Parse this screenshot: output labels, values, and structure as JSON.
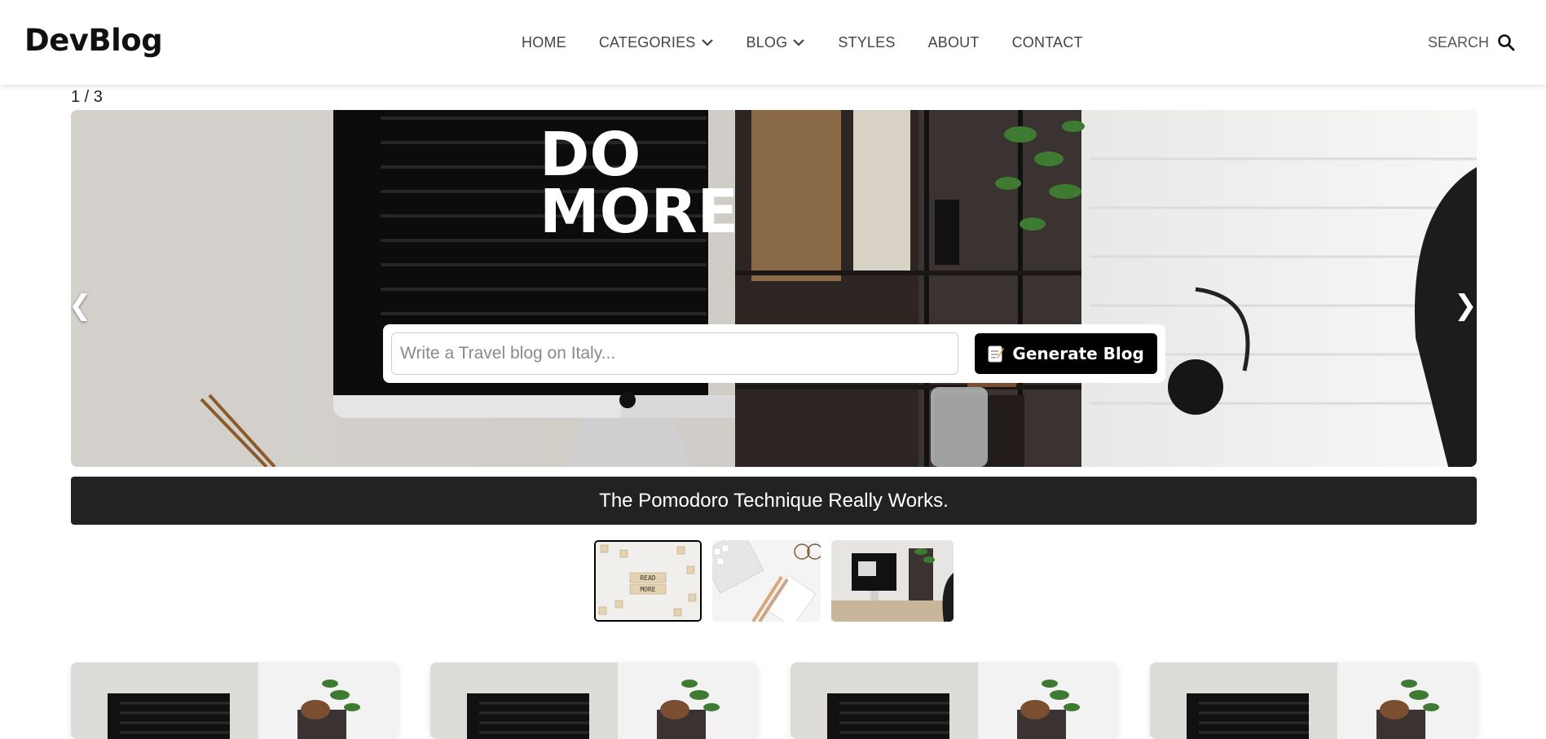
{
  "header": {
    "logo": "DevBlog",
    "nav": [
      {
        "label": "HOME",
        "dropdown": false
      },
      {
        "label": "CATEGORIES",
        "dropdown": true
      },
      {
        "label": "BLOG",
        "dropdown": true
      },
      {
        "label": "STYLES",
        "dropdown": false
      },
      {
        "label": "ABOUT",
        "dropdown": false
      },
      {
        "label": "CONTACT",
        "dropdown": false
      }
    ],
    "search_label": "SEARCH"
  },
  "slider": {
    "counter": "1 / 3",
    "prev": "❮",
    "next": "❯",
    "generator": {
      "placeholder": "Write a Travel blog on Italy...",
      "button_label": "Generate Blog",
      "button_icon": "memo-icon"
    },
    "caption": "The Pomodoro Technique Really Works.",
    "wall_text_line1": "DO",
    "wall_text_line2": "MORE.",
    "thumbnails": [
      {
        "name": "read-more-tiles",
        "active": true
      },
      {
        "name": "keyboard-desk",
        "active": false
      },
      {
        "name": "imac-workspace",
        "active": false
      }
    ],
    "thumb_text_line1": "READ",
    "thumb_text_line2": "MORE"
  },
  "colors": {
    "caption_bg": "#222222",
    "button_bg": "#000000",
    "text_dark": "#111111",
    "nav_text": "#444444"
  },
  "cards": [
    {
      "image": "imac-desk-plant"
    },
    {
      "image": "imac-desk-plant"
    },
    {
      "image": "imac-desk-plant"
    },
    {
      "image": "imac-desk-plant"
    }
  ]
}
